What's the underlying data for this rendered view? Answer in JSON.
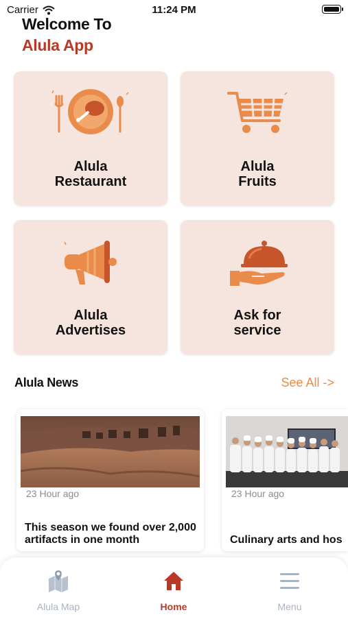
{
  "status_bar": {
    "carrier": "Carrier",
    "time": "11:24 PM"
  },
  "header": {
    "welcome": "Welcome To",
    "app_name": "Alula App"
  },
  "cards": [
    {
      "label_line1": "Alula",
      "label_line2": "Restaurant",
      "icon": "restaurant-plate-icon"
    },
    {
      "label_line1": "Alula",
      "label_line2": "Fruits",
      "icon": "shopping-cart-icon"
    },
    {
      "label_line1": "Alula",
      "label_line2": "Advertises",
      "icon": "megaphone-icon"
    },
    {
      "label_line1": "Ask for",
      "label_line2": "service",
      "icon": "service-cloche-icon"
    }
  ],
  "news": {
    "title": "Alula News",
    "see_all": "See All ->",
    "items": [
      {
        "time": "23 Hour ago",
        "headline_line1": "This season we found over 2,000",
        "headline_line2": "artifacts in one month"
      },
      {
        "time": "23 Hour ago",
        "headline_line1": "Culinary arts and hos",
        "headline_line2": ""
      }
    ]
  },
  "tabbar": {
    "items": [
      {
        "label": "Alula Map",
        "icon": "map-icon"
      },
      {
        "label": "Home",
        "icon": "home-icon"
      },
      {
        "label": "Menu",
        "icon": "menu-icon"
      }
    ]
  },
  "colors": {
    "accent": "#b83a26",
    "orange": "#ee8a43",
    "card_bg": "#f6e5df",
    "tab_inactive": "#a8b3c2"
  }
}
